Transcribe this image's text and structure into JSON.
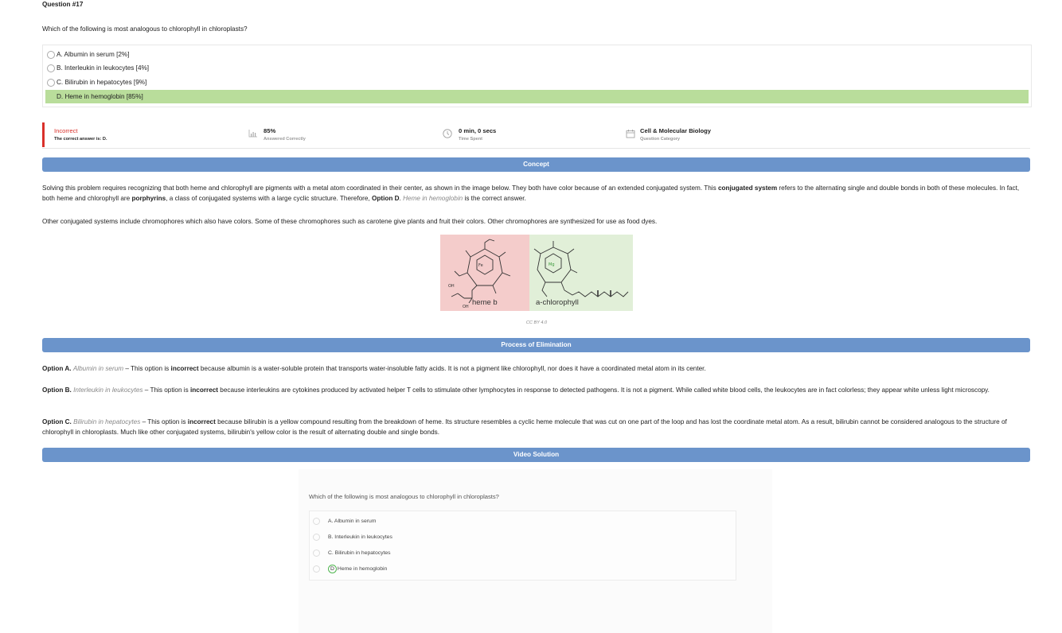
{
  "question": {
    "number": "Question #17",
    "text": "Which of the following is most analogous to chlorophyll in chloroplasts?",
    "options": [
      {
        "label": "A. Albumin in serum [2%]"
      },
      {
        "label": "B. Interleukin in leukocytes [4%]"
      },
      {
        "label": "C. Bilirubin in hepatocytes [9%]"
      },
      {
        "label": "D. Heme in hemoglobin [85%]"
      }
    ]
  },
  "stats": {
    "result": "Incorrect",
    "correct_answer": "The correct answer is: D.",
    "percent": "85%",
    "percent_label": "Answered Correctly",
    "time": "0 min, 0 secs",
    "time_label": "Time Spent",
    "category": "Cell & Molecular Biology",
    "category_label": "Question Category"
  },
  "concept": {
    "title": "Concept",
    "p1_a": "Solving this problem requires recognizing that both heme and chlorophyll are pigments with a metal atom coordinated in their center, as shown in the image below. They both have color because of an extended conjugated system. This ",
    "p1_b": "conjugated system",
    "p1_c": " refers to the alternating single and double bonds in both of these molecules. In fact, both heme and chlorophyll are ",
    "p1_d": "porphyrins",
    "p1_e": ", a class of conjugated systems with a large cyclic structure. Therefore, ",
    "p1_f": "Option D",
    "p1_g": ". ",
    "p1_h": "Heme in hemoglobin",
    "p1_i": " is the correct answer.",
    "p2": "Other conjugated systems include chromophores which also have colors. Some of these chromophores such as carotene give plants and fruit their colors. Other chromophores are synthesized for use as food dyes.",
    "figure_left_label": "heme b",
    "figure_right_label": "a-chlorophyll",
    "caption": "CC BY 4.0"
  },
  "elimination": {
    "title": "Process of Elimination",
    "a_option": "Option A.",
    "a_name": "Albumin in serum",
    "a_1": " – This option is ",
    "a_bold": "incorrect",
    "a_2": " because albumin is a water-soluble protein that transports water-insoluble fatty acids. It is not a pigment like chlorophyll, nor does it have a coordinated metal atom in its center.",
    "b_option": "Option B.",
    "b_name": "Interleukin in leukocytes",
    "b_1": " – This option is ",
    "b_bold": "incorrect",
    "b_2": " because interleukins are cytokines produced by activated helper T cells to stimulate other lymphocytes in response to detected pathogens. It is not a pigment. While called white blood cells, the leukocytes are in fact colorless; they appear white unless light microscopy.",
    "c_option": "Option C.",
    "c_name": "Bilirubin in hepatocytes",
    "c_1": " – This option is ",
    "c_bold": "incorrect",
    "c_2": " because bilirubin is a yellow compound resulting from the breakdown of heme. Its structure resembles a cyclic heme molecule that was cut on one part of the loop and has lost the coordinate metal atom. As a result, bilirubin cannot be considered analogous to the structure of chlorophyll in chloroplasts. Much like other conjugated systems, bilirubin's yellow color is the result of alternating double and single bonds."
  },
  "video": {
    "title": "Video Solution",
    "question": "Which of the following is most analogous to chlorophyll in chloroplasts?",
    "options": [
      {
        "label": "A. Albumin in serum"
      },
      {
        "label": "B. Interleukin in leukocytes"
      },
      {
        "label": "C. Bilirubin in hepatocytes"
      },
      {
        "label": "Heme in hemoglobin"
      }
    ],
    "circled_letter": "D"
  },
  "colors": {
    "correct_bg": "#b9dd9b",
    "incorrect_red": "#d9302a",
    "banner_blue": "#6b94cb"
  }
}
